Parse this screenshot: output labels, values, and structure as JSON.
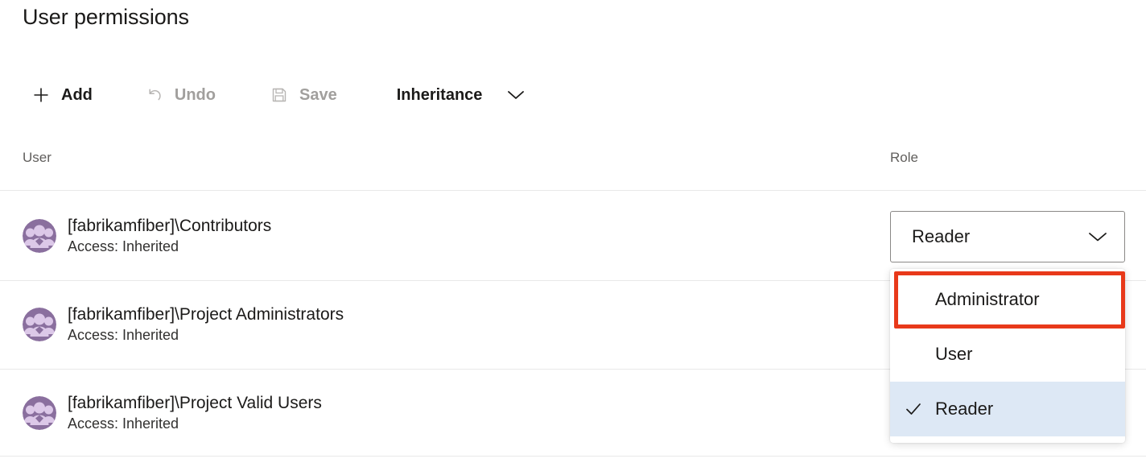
{
  "page": {
    "title": "User permissions"
  },
  "toolbar": {
    "items": [
      {
        "label": "Add",
        "icon": "plus-icon",
        "enabled": true
      },
      {
        "label": "Undo",
        "icon": "undo-arrow-icon",
        "enabled": false
      },
      {
        "label": "Save",
        "icon": "floppy-disk-icon",
        "enabled": false
      },
      {
        "label": "Inheritance",
        "icon": "chevron-down-icon",
        "enabled": true
      }
    ]
  },
  "table": {
    "columns": [
      "User",
      "Role"
    ],
    "rows": [
      {
        "avatar_icon": "group-avatar-icon",
        "name": "[fabrikamfiber]\\Contributors",
        "access": "Access: Inherited"
      },
      {
        "avatar_icon": "group-avatar-icon",
        "name": "[fabrikamfiber]\\Project Administrators",
        "access": "Access: Inherited"
      },
      {
        "avatar_icon": "group-avatar-icon",
        "name": "[fabrikamfiber]\\Project Valid Users",
        "access": "Access: Inherited"
      }
    ]
  },
  "role_dropdown": {
    "selected_value": "Reader",
    "expanded": true,
    "options": [
      {
        "label": "Administrator",
        "checked": false,
        "highlighted": true
      },
      {
        "label": "User",
        "checked": false,
        "highlighted": false
      },
      {
        "label": "Reader",
        "checked": true,
        "highlighted": false
      }
    ],
    "checkmark_icon": "check-icon",
    "chevron_icon": "chevron-down-icon"
  },
  "colors": {
    "highlight_annotation": "#e8391a",
    "selected_option_bg": "#dde8f5",
    "avatar_bg": "#8a6f9e",
    "avatar_fg": "#dcc8e8",
    "text_primary": "#1b1a19",
    "text_secondary": "#605e5c",
    "text_disabled": "#a19f9d",
    "divider": "#e8e8e8",
    "combobox_border": "#8a8886"
  }
}
